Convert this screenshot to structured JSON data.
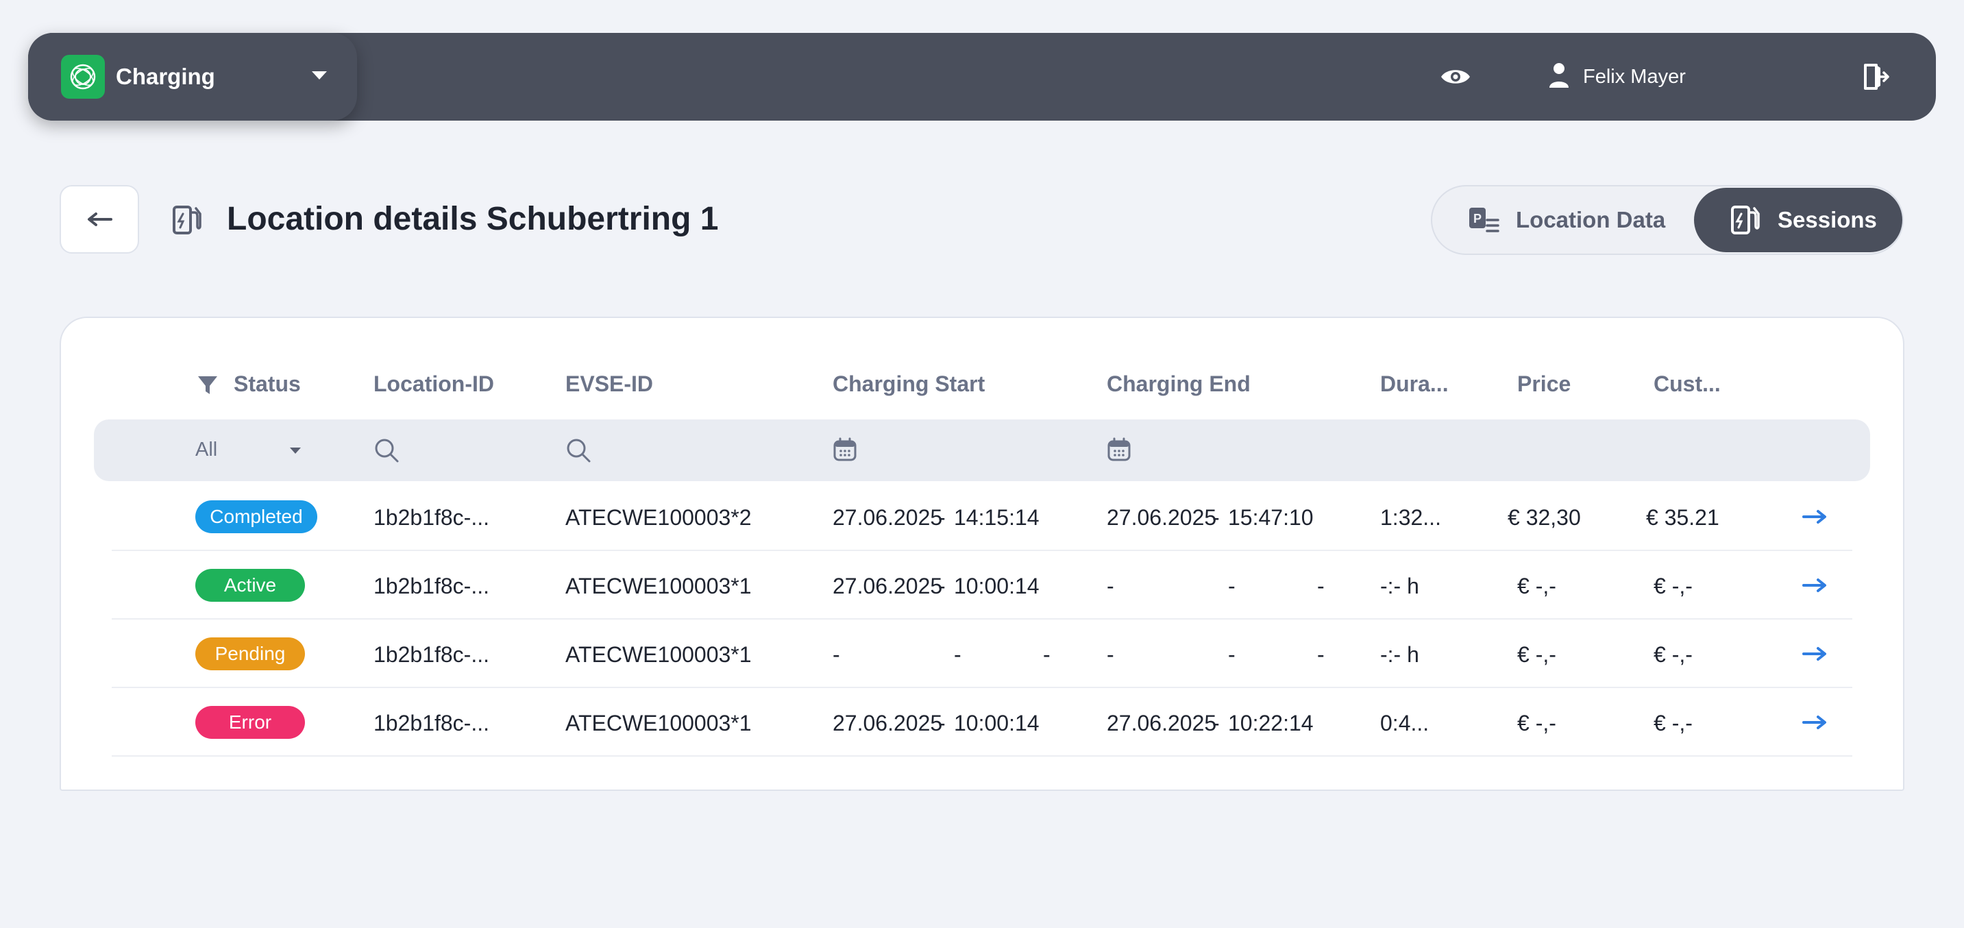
{
  "app": {
    "name": "Charging",
    "user_name": "Felix Mayer"
  },
  "page": {
    "title": "Location details Schubertring 1"
  },
  "tabs": {
    "location_data": "Location Data",
    "sessions": "Sessions"
  },
  "table": {
    "headers": {
      "status": "Status",
      "location_id": "Location-ID",
      "evse_id": "EVSE-ID",
      "charging_start": "Charging Start",
      "charging_end": "Charging End",
      "duration": "Dura...",
      "price": "Price",
      "customer": "Cust..."
    },
    "filters": {
      "status": "All"
    },
    "rows": [
      {
        "status": "Completed",
        "location_id": "1b2b1f8c-...",
        "evse_id": "ATECWE100003*2",
        "start": [
          "27.06.2025",
          "-",
          "14:15:14"
        ],
        "end": [
          "27.06.2025",
          "-",
          "15:47:10"
        ],
        "duration": "1:32...",
        "price": "€ 32,30",
        "customer": "€ 35.21"
      },
      {
        "status": "Active",
        "location_id": "1b2b1f8c-...",
        "evse_id": "ATECWE100003*1",
        "start": [
          "27.06.2025",
          "-",
          "10:00:14"
        ],
        "end": [
          "-",
          "-",
          "-"
        ],
        "duration": "-:- h",
        "price": "€ -,-",
        "customer": "€ -,-"
      },
      {
        "status": "Pending",
        "location_id": "1b2b1f8c-...",
        "evse_id": "ATECWE100003*1",
        "start": [
          "-",
          "-",
          "-"
        ],
        "end": [
          "-",
          "-",
          "-"
        ],
        "duration": "-:- h",
        "price": "€ -,-",
        "customer": "€ -,-"
      },
      {
        "status": "Error",
        "location_id": "1b2b1f8c-...",
        "evse_id": "ATECWE100003*1",
        "start": [
          "27.06.2025",
          "-",
          "10:00:14"
        ],
        "end": [
          "27.06.2025",
          "-",
          "10:22:14"
        ],
        "duration": "0:4...",
        "price": "€ -,-",
        "customer": "€ -,-"
      }
    ]
  },
  "colors": {
    "topbar": "#4a4f5c",
    "status_completed": "#1a9be8",
    "status_active": "#1fb25a",
    "status_pending": "#e99a1a",
    "status_error": "#ef2f6c",
    "row_arrow": "#2f7de1"
  },
  "icons": {
    "app_logo": "charging-logo-icon",
    "visibility": "eye-icon",
    "user": "user-icon",
    "logout": "logout-icon",
    "back": "arrow-left-icon",
    "location": "charging-station-icon",
    "filter": "filter-icon",
    "search": "search-icon",
    "calendar": "calendar-icon",
    "row_open": "arrow-right-icon"
  }
}
